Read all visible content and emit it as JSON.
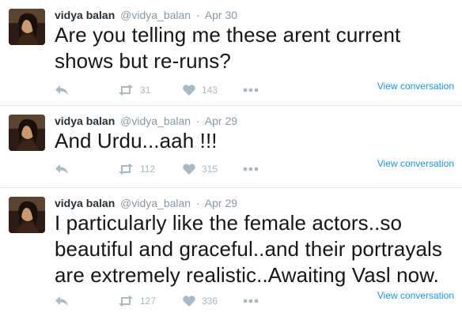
{
  "tweets": [
    {
      "fullname": "vidya balan",
      "handle": "@vidya_balan",
      "separator": "·",
      "time": "Apr 30",
      "text": "Are you telling me these arent current shows but re-runs?",
      "retweets": "31",
      "likes": "143",
      "view_conversation": "View conversation"
    },
    {
      "fullname": "vidya balan",
      "handle": "@vidya_balan",
      "separator": "·",
      "time": "Apr 29",
      "text": "And Urdu...aah !!!",
      "retweets": "112",
      "likes": "315",
      "view_conversation": "View conversation"
    },
    {
      "fullname": "vidya balan",
      "handle": "@vidya_balan",
      "separator": "·",
      "time": "Apr 29",
      "text": "I particularly like the female actors..so beautiful and graceful..and their portrayals are extremely realistic..Awaiting Vasl now.",
      "retweets": "127",
      "likes": "336",
      "view_conversation": "View conversation"
    }
  ],
  "icons": {
    "reply": "reply-icon",
    "retweet": "retweet-icon",
    "like": "heart-icon",
    "more": "more-icon"
  },
  "colors": {
    "link": "#1b95e0",
    "muted": "#8899a6",
    "action": "#aab8c2",
    "divider": "#e1e8ed"
  }
}
